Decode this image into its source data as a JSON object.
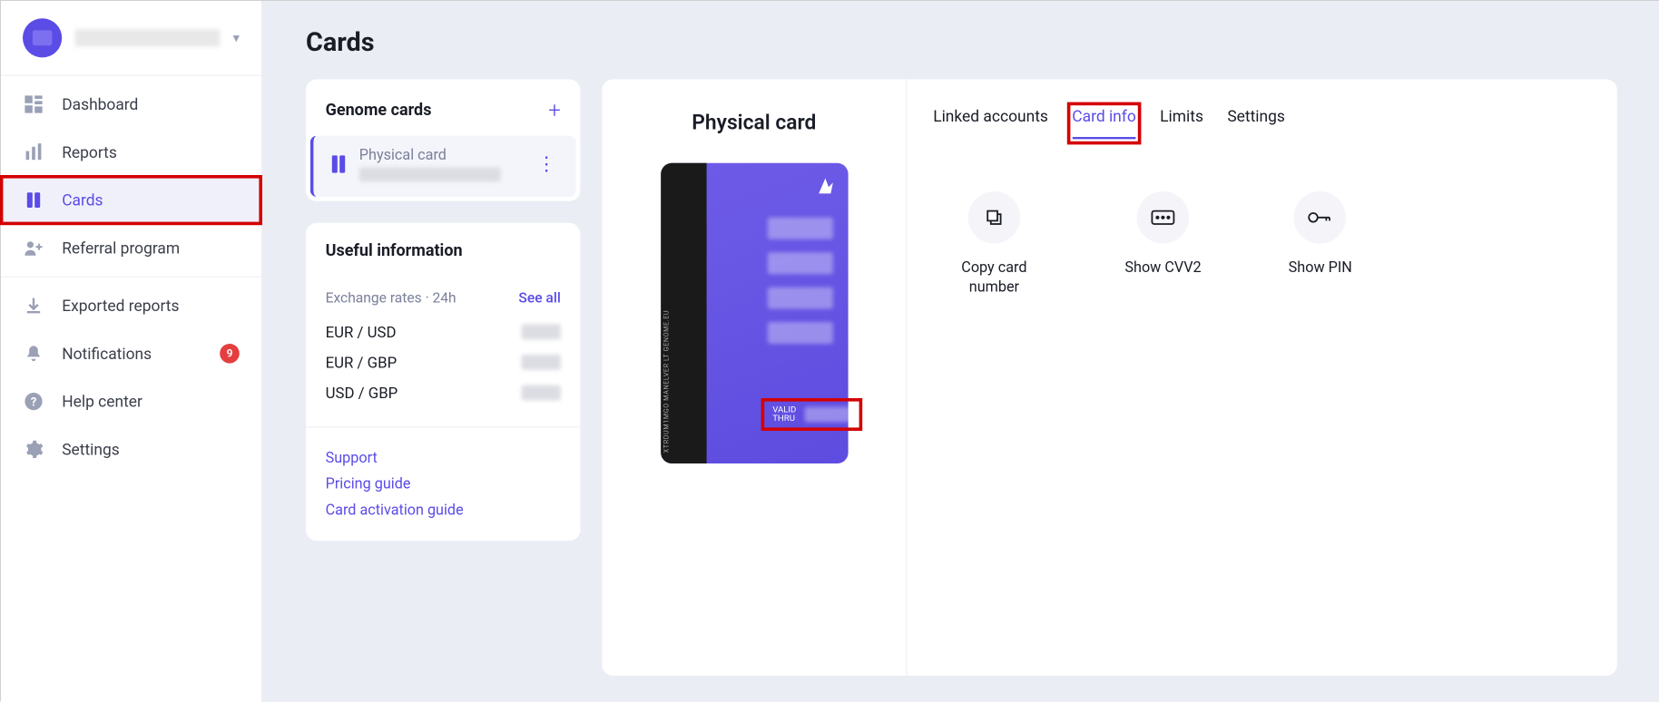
{
  "colors": {
    "accent": "#5b4ce6",
    "danger": "#d40000"
  },
  "page": {
    "title": "Cards"
  },
  "sidebar": {
    "user_name": "",
    "items": [
      {
        "label": "Dashboard",
        "icon": "dashboard"
      },
      {
        "label": "Reports",
        "icon": "reports"
      },
      {
        "label": "Cards",
        "icon": "cards",
        "active": true,
        "highlighted": true
      },
      {
        "label": "Referral program",
        "icon": "referral"
      }
    ],
    "secondary": [
      {
        "label": "Exported reports",
        "icon": "download"
      },
      {
        "label": "Notifications",
        "icon": "bell",
        "badge": "9"
      },
      {
        "label": "Help center",
        "icon": "help"
      },
      {
        "label": "Settings",
        "icon": "gear"
      }
    ]
  },
  "genome_cards": {
    "title": "Genome cards",
    "items": [
      {
        "type_label": "Physical card",
        "masked_number": ""
      }
    ]
  },
  "useful_info": {
    "title": "Useful information",
    "rates": {
      "header": "Exchange rates · 24h",
      "see_all": "See all",
      "rows": [
        {
          "pair": "EUR / USD",
          "value": ""
        },
        {
          "pair": "EUR / GBP",
          "value": ""
        },
        {
          "pair": "USD / GBP",
          "value": ""
        }
      ]
    },
    "links": [
      "Support",
      "Pricing guide",
      "Card activation guide"
    ]
  },
  "card_detail": {
    "title": "Physical card",
    "valid_label": "VALID\nTHRU",
    "side_text": "XTRDUM1MGO   MANELVER LT   GENOME.EU",
    "tabs": [
      {
        "label": "Linked accounts"
      },
      {
        "label": "Card info",
        "active": true,
        "highlighted": true
      },
      {
        "label": "Limits"
      },
      {
        "label": "Settings"
      }
    ],
    "actions": [
      {
        "label": "Copy card number",
        "icon": "copy"
      },
      {
        "label": "Show CVV2",
        "icon": "cvv"
      },
      {
        "label": "Show PIN",
        "icon": "key"
      }
    ]
  }
}
